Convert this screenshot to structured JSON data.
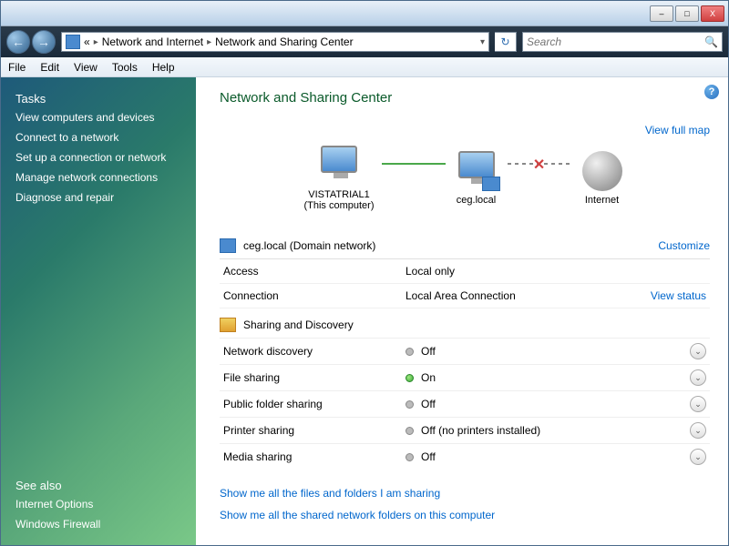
{
  "titlebar": {
    "min": "–",
    "max": "□",
    "close": "X"
  },
  "nav": {
    "back": "←",
    "fwd": "→"
  },
  "breadcrumb": {
    "root": "«",
    "group": "Network and Internet",
    "page": "Network and Sharing Center",
    "sep": "▸",
    "drop": "▾",
    "refresh": "↻"
  },
  "search": {
    "placeholder": "Search",
    "icon": "🔍"
  },
  "menu": {
    "file": "File",
    "edit": "Edit",
    "view": "View",
    "tools": "Tools",
    "help": "Help"
  },
  "sidebar": {
    "tasks_heading": "Tasks",
    "items": [
      "View computers and devices",
      "Connect to a network",
      "Set up a connection or network",
      "Manage network connections",
      "Diagnose and repair"
    ],
    "see_also": "See also",
    "see_items": [
      "Internet Options",
      "Windows Firewall"
    ]
  },
  "content": {
    "title": "Network and Sharing Center",
    "view_full_map": "View full map",
    "map": {
      "computer_name": "VISTATRIAL1",
      "computer_sub": "(This computer)",
      "network_name": "ceg.local",
      "internet": "Internet",
      "x": "✕"
    },
    "network_section": {
      "title": "ceg.local (Domain network)",
      "customize": "Customize",
      "access_label": "Access",
      "access_value": "Local only",
      "connection_label": "Connection",
      "connection_value": "Local Area Connection",
      "view_status": "View status"
    },
    "discovery": {
      "heading": "Sharing and Discovery",
      "rows": [
        {
          "label": "Network discovery",
          "state": "off",
          "text": "Off"
        },
        {
          "label": "File sharing",
          "state": "on",
          "text": "On"
        },
        {
          "label": "Public folder sharing",
          "state": "off",
          "text": "Off"
        },
        {
          "label": "Printer sharing",
          "state": "off",
          "text": "Off (no printers installed)"
        },
        {
          "label": "Media sharing",
          "state": "off",
          "text": "Off"
        }
      ],
      "chevron": "⌄"
    },
    "bottom_links": [
      "Show me all the files and folders I am sharing",
      "Show me all the shared network folders on this computer"
    ],
    "help": "?"
  }
}
